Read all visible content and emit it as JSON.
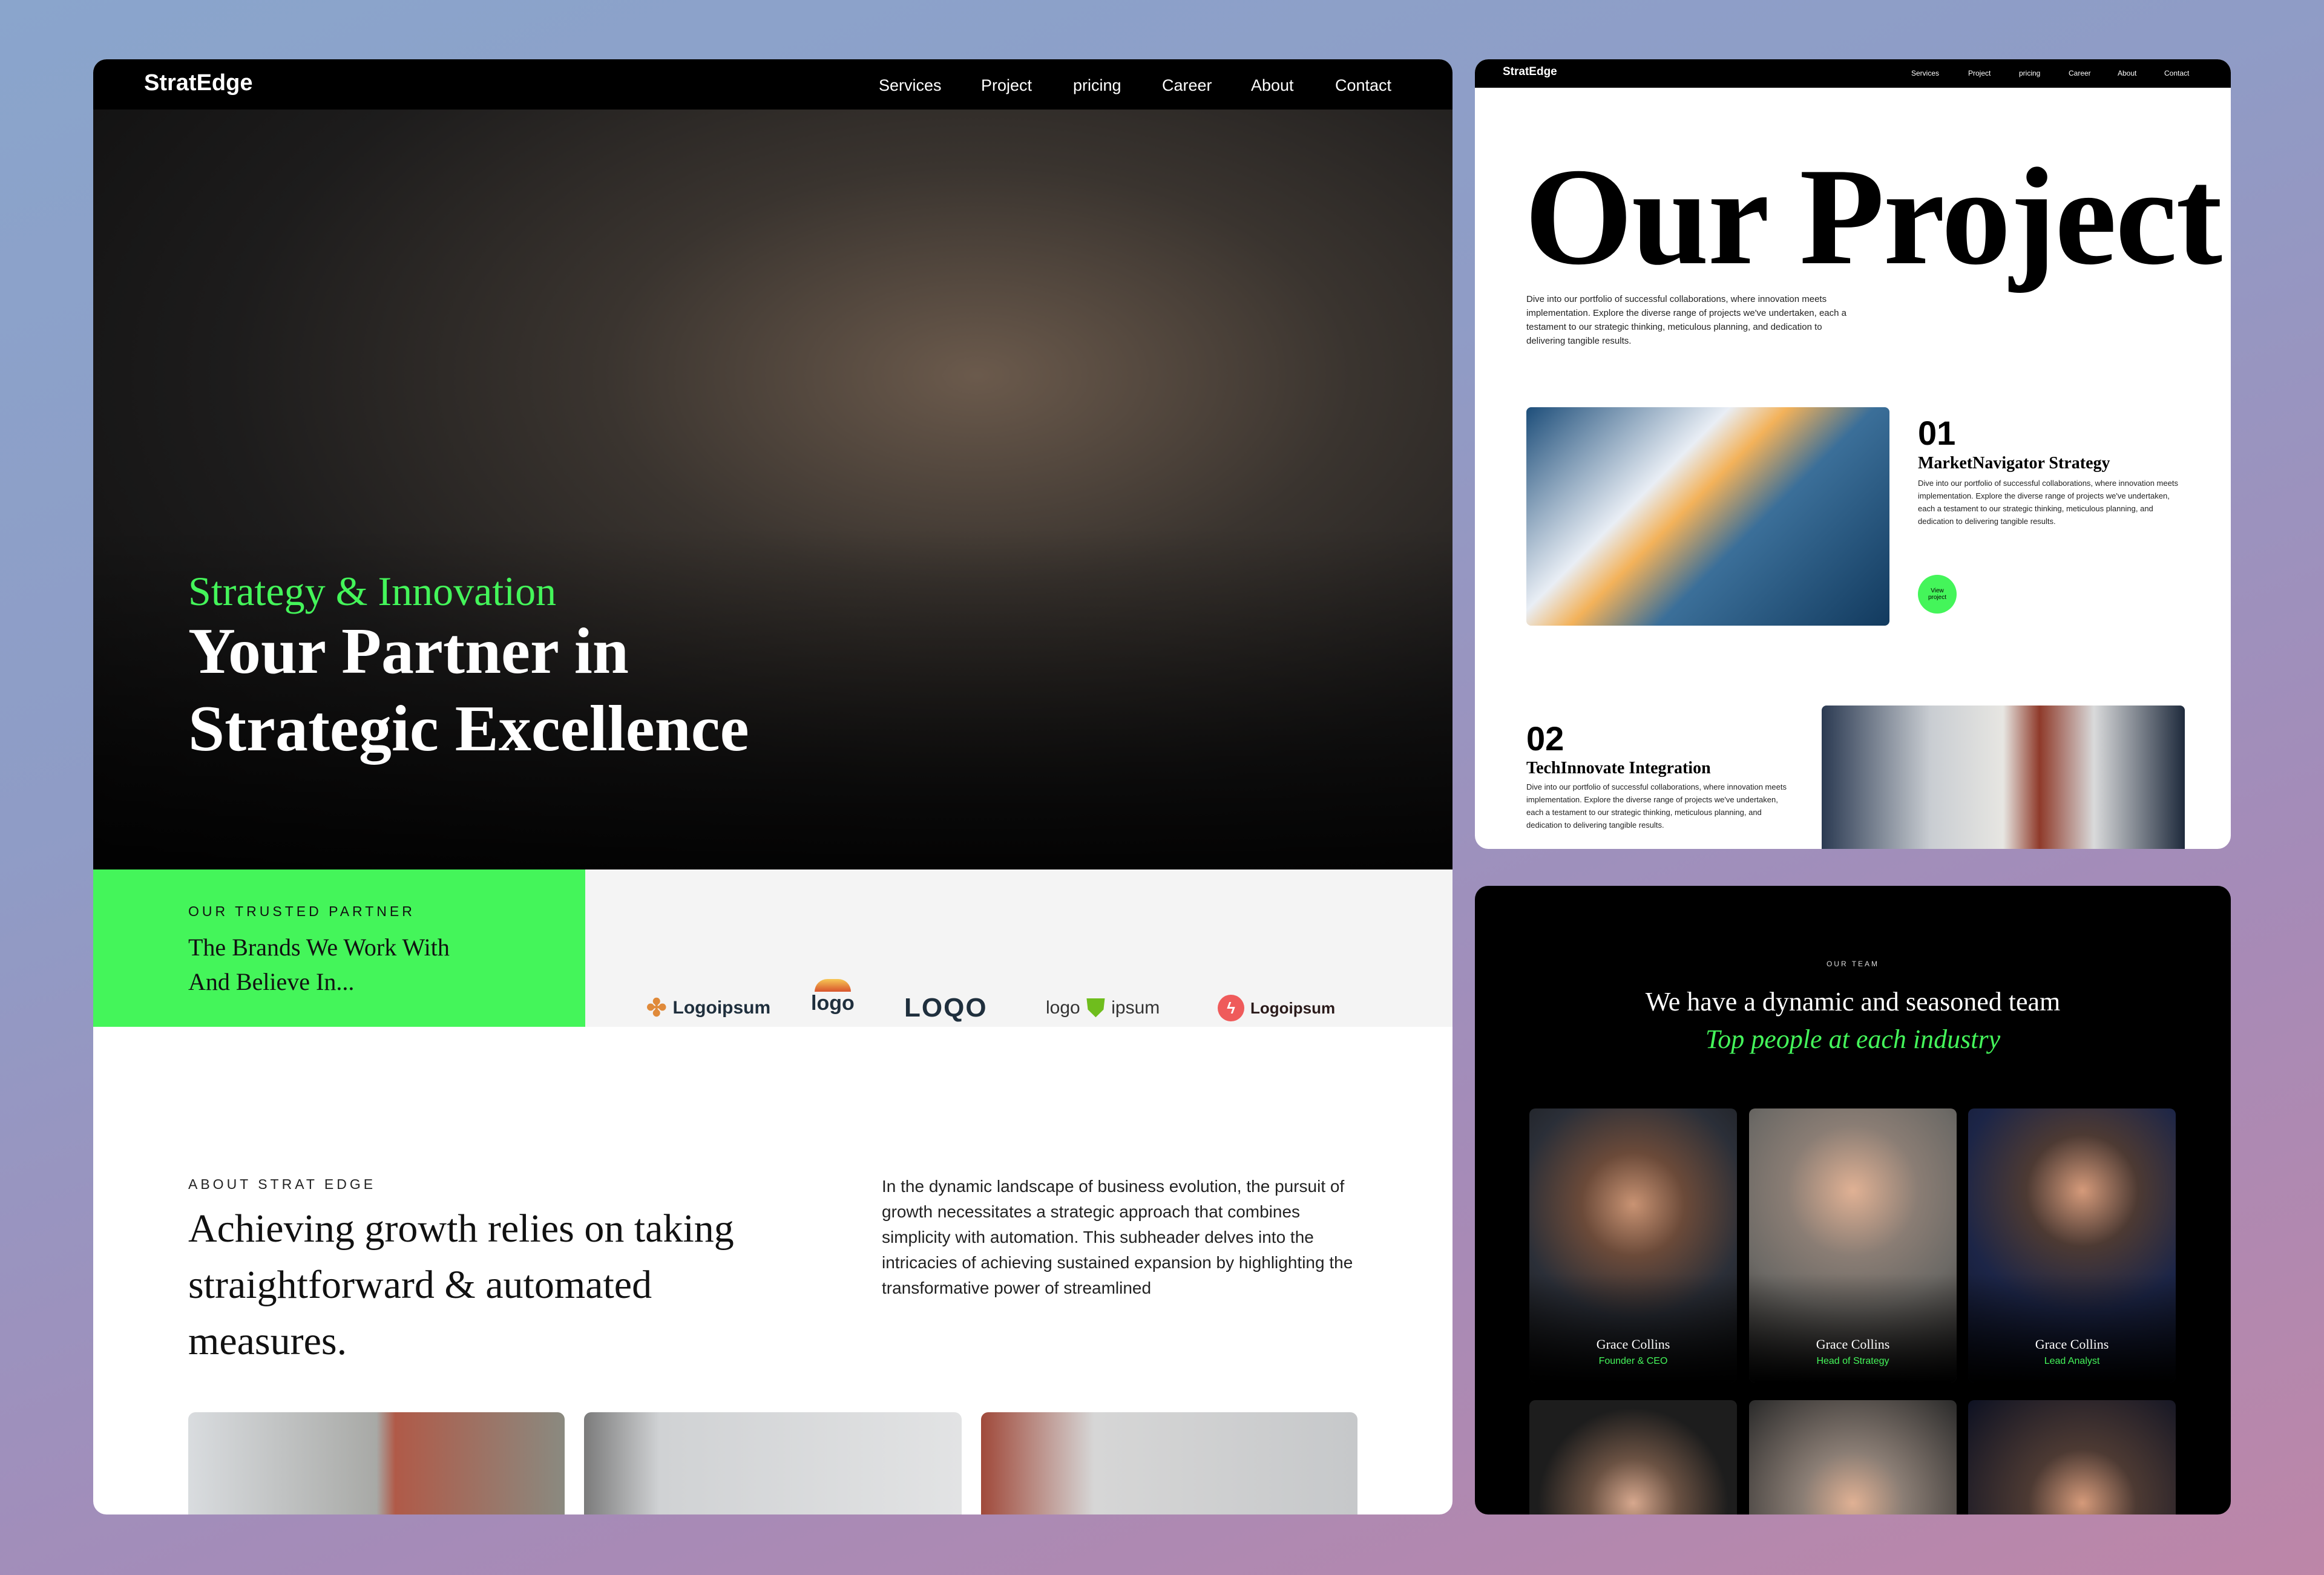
{
  "main_site": {
    "nav": {
      "brand": "StratEdge",
      "items": [
        "Services",
        "Project",
        "pricing",
        "Career",
        "About",
        "Contact"
      ]
    },
    "hero": {
      "eyebrow": "Strategy & Innovation",
      "title_line1": "Your Partner in",
      "title_line2": "Strategic Excellence"
    },
    "partners": {
      "label": "OUR TRUSTED PARTNER",
      "title_line1": "The Brands We Work With",
      "title_line2": "And Believe In...",
      "logos": [
        "Logoipsum",
        "logo",
        "LOQO",
        "logo",
        "ipsum",
        "Logoipsum"
      ]
    },
    "about": {
      "label": "ABOUT STRAT EDGE",
      "heading_line1": "Achieving growth relies on taking",
      "heading_line2": "straightforward & automated",
      "heading_line3": "measures.",
      "body": "In the dynamic landscape of business evolution, the pursuit of growth necessitates a strategic approach that combines simplicity with automation. This subheader delves into the intricacies of achieving sustained expansion by highlighting the transformative power of streamlined"
    }
  },
  "project_page": {
    "nav": {
      "brand": "StratEdge",
      "items": [
        "Services",
        "Project",
        "pricing",
        "Career",
        "About",
        "Contact"
      ]
    },
    "title": "Our Project",
    "intro": "Dive into our portfolio of successful collaborations, where innovation meets implementation. Explore the diverse range of projects we've undertaken, each a testament to our strategic thinking, meticulous planning, and dedication to delivering tangible results.",
    "projects": [
      {
        "number": "01",
        "title": "MarketNavigator Strategy",
        "description": "Dive into our portfolio of successful collaborations, where innovation meets implementation. Explore the diverse range of projects we've undertaken, each a testament to our strategic thinking, meticulous planning, and dedication to delivering tangible results.",
        "button": "View project"
      },
      {
        "number": "02",
        "title": "TechInnovate Integration",
        "description": "Dive into our portfolio of successful collaborations, where innovation meets implementation. Explore the diverse range of projects we've undertaken, each a testament to our strategic thinking, meticulous planning, and dedication to delivering tangible results."
      }
    ]
  },
  "team_page": {
    "label": "OUR TEAM",
    "heading": "We have a dynamic and seasoned team",
    "subheading": "Top people at each industry",
    "members": [
      {
        "name": "Grace Collins",
        "role": "Founder & CEO"
      },
      {
        "name": "Grace Collins",
        "role": "Head of Strategy"
      },
      {
        "name": "Grace Collins",
        "role": "Lead Analyst"
      }
    ]
  },
  "colors": {
    "accent": "#44f55a",
    "dark": "#000000",
    "light_gray": "#f4f4f4"
  }
}
